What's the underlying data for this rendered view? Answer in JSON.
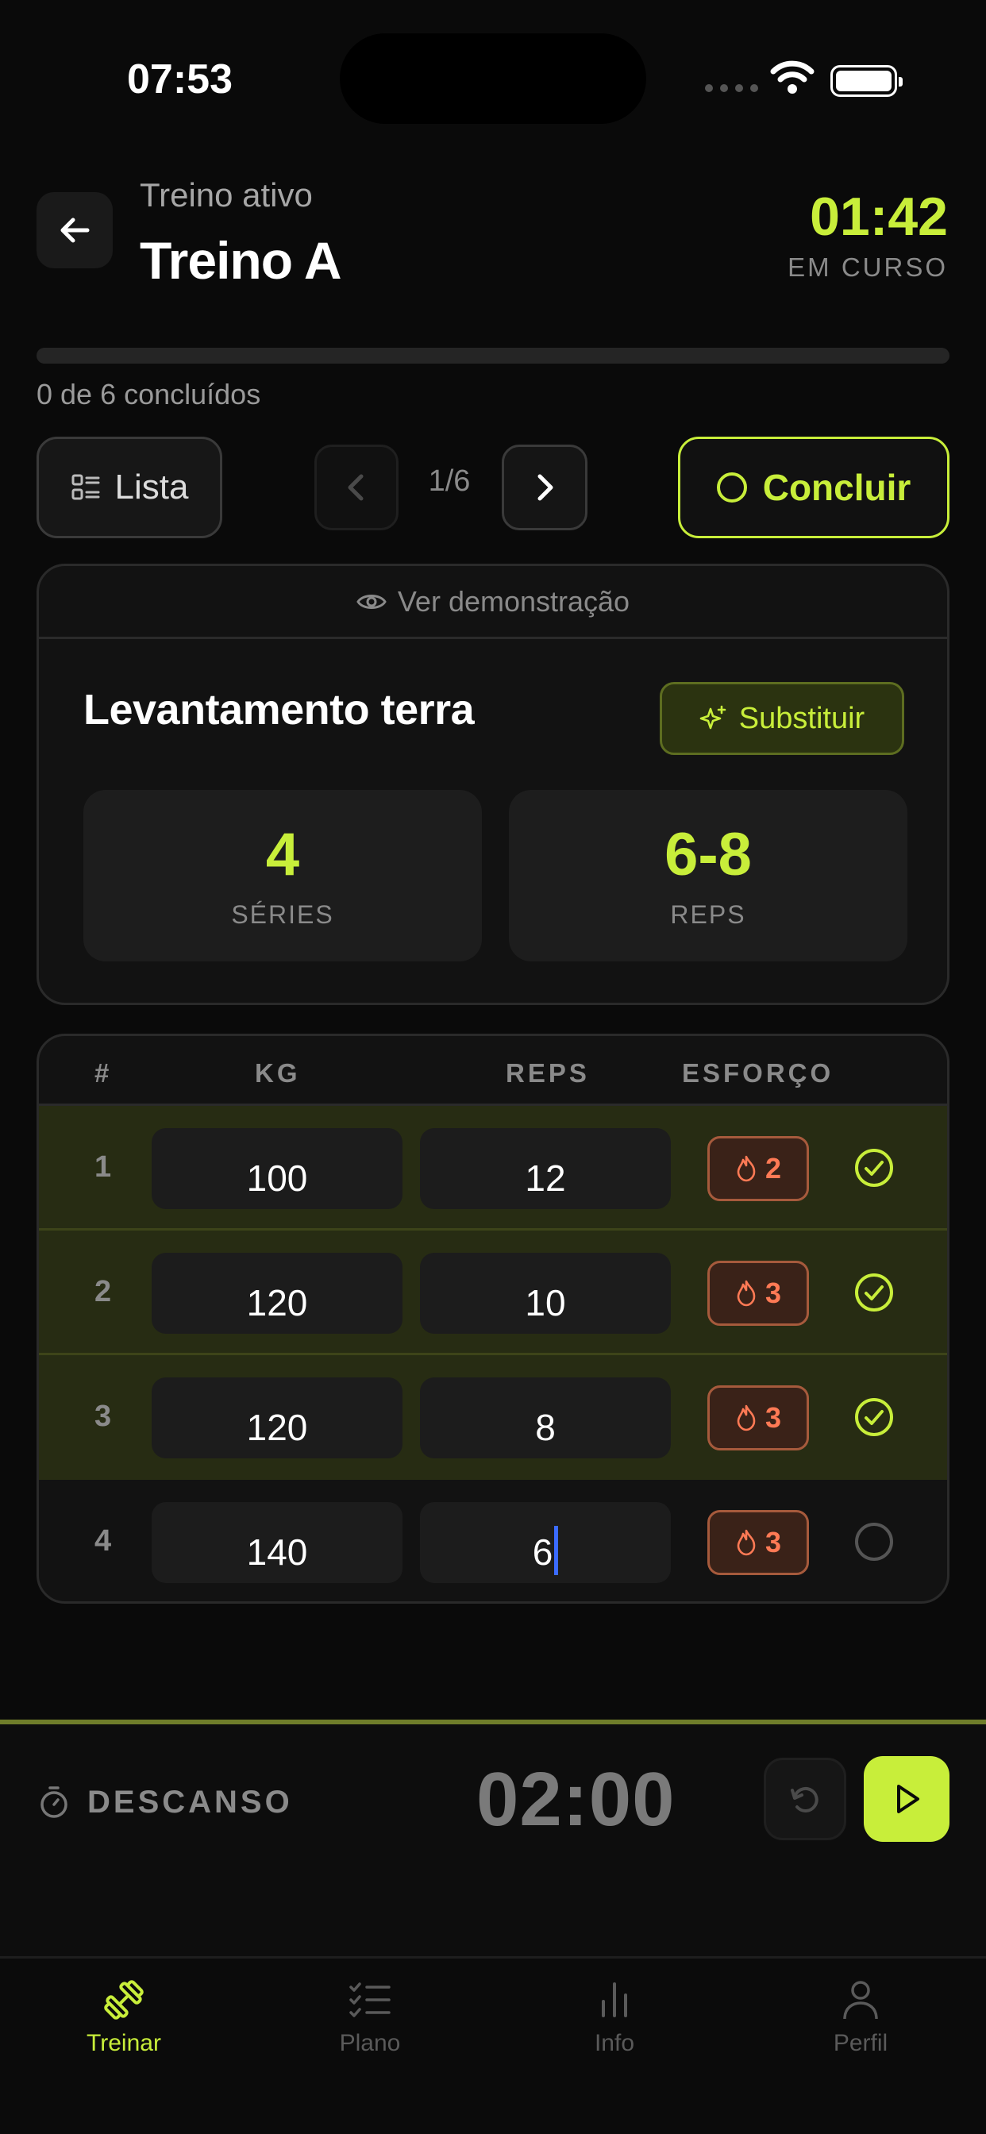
{
  "status_bar": {
    "time": "07:53"
  },
  "header": {
    "subtitle": "Treino ativo",
    "title": "Treino A",
    "timer": "01:42",
    "timer_label": "EM CURSO"
  },
  "progress": {
    "text": "0 de 6 concluídos",
    "completed": 0,
    "total": 6
  },
  "controls": {
    "list_label": "Lista",
    "pager": "1/6",
    "finish_label": "Concluir"
  },
  "exercise": {
    "demo_label": "Ver demonstração",
    "name": "Levantamento terra",
    "substitute_label": "Substituir",
    "sets_value": "4",
    "sets_label": "SÉRIES",
    "reps_value": "6-8",
    "reps_label": "REPS"
  },
  "table": {
    "headers": {
      "num": "#",
      "kg": "KG",
      "reps": "REPS",
      "effort": "ESFORÇO"
    },
    "rows": [
      {
        "num": "1",
        "kg": "100",
        "reps": "12",
        "effort": "2",
        "done": true
      },
      {
        "num": "2",
        "kg": "120",
        "reps": "10",
        "effort": "3",
        "done": true
      },
      {
        "num": "3",
        "kg": "120",
        "reps": "8",
        "effort": "3",
        "done": true
      },
      {
        "num": "4",
        "kg": "140",
        "reps": "6",
        "effort": "3",
        "done": false
      }
    ]
  },
  "rest": {
    "label": "DESCANSO",
    "time": "02:00"
  },
  "tabs": [
    {
      "label": "Treinar",
      "icon": "dumbbell-icon",
      "active": true
    },
    {
      "label": "Plano",
      "icon": "checklist-icon",
      "active": false
    },
    {
      "label": "Info",
      "icon": "bar-chart-icon",
      "active": false
    },
    {
      "label": "Perfil",
      "icon": "user-icon",
      "active": false
    }
  ],
  "colors": {
    "accent": "#c8ee3a",
    "background": "#0a0a0a",
    "effort": "#ff7a55"
  }
}
